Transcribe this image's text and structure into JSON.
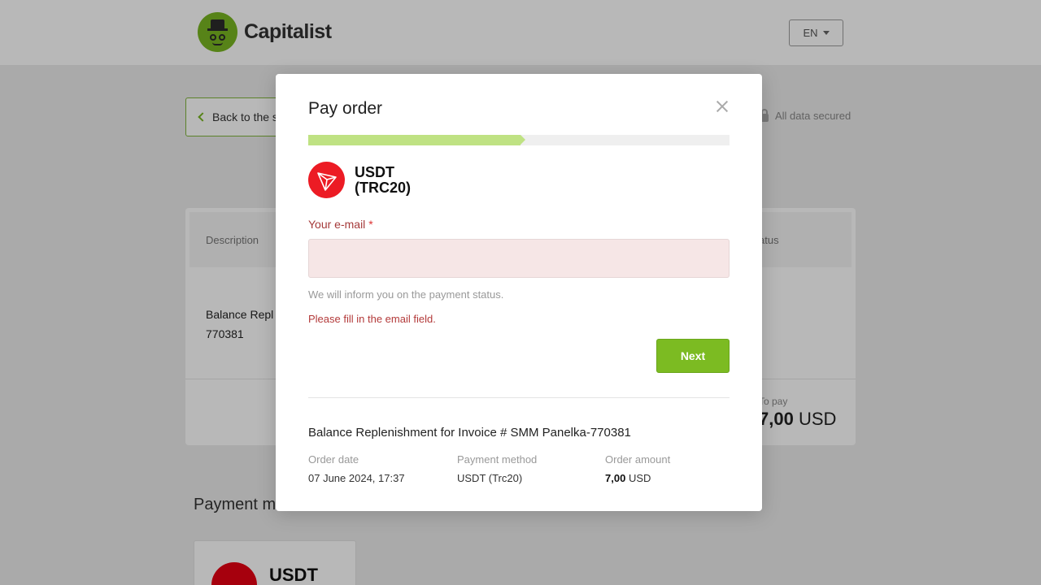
{
  "header": {
    "brand": "Capitalist",
    "lang": "EN"
  },
  "page": {
    "back_label": "Back to the s",
    "secured_label": "All data secured",
    "order_table": {
      "col_description": "Description",
      "col_status": "atus",
      "row_description": "Balance Repl\n770381",
      "topay_label": "To pay",
      "topay_amount": "7,00",
      "topay_currency": "USD"
    },
    "payment_method_title": "Payment method",
    "payment_method_card": "USDT"
  },
  "modal": {
    "title": "Pay order",
    "progress_fraction": 0.5,
    "method_name": "USDT\n(TRC20)",
    "email_label": "Your e-mail",
    "required_mark": "*",
    "email_value": "",
    "email_placeholder": "",
    "hint": "We will inform you on the payment status.",
    "error": "Please fill in the email field.",
    "next_label": "Next",
    "summary_title": "Balance Replenishment for Invoice # SMM Panelka-770381",
    "order_date_label": "Order date",
    "order_date_value": "07 June 2024, 17:37",
    "payment_method_label": "Payment method",
    "payment_method_value": "USDT (Trc20)",
    "order_amount_label": "Order amount",
    "order_amount_value": "7,00",
    "order_amount_currency": "USD"
  },
  "colors": {
    "brand_green": "#79b622",
    "progress_fill": "#bfe283",
    "tron_red": "#ec1b24",
    "error_red": "#b33a3a",
    "button_green": "#7cbb22"
  },
  "icons": [
    "capitalist-logo-icon",
    "chevron-down-icon",
    "chevron-left-icon",
    "lock-icon",
    "close-icon",
    "tron-icon"
  ]
}
